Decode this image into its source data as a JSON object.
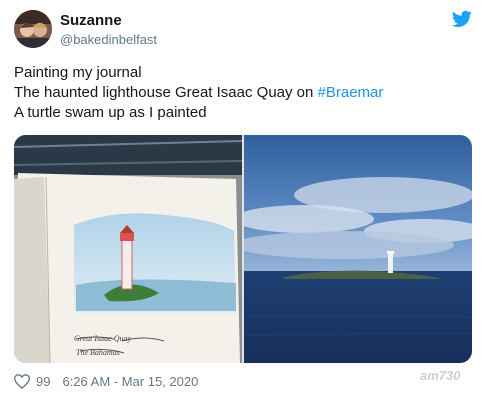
{
  "author": {
    "name": "Suzanne",
    "handle": "@bakedinbelfast"
  },
  "tweet": {
    "line1": "Painting my journal",
    "line2_prefix": "The haunted lighthouse Great Isaac Quay on ",
    "hashtag": "#Braemar",
    "line3": "A turtle swam up as I painted"
  },
  "media": {
    "left_sketch_caption": [
      "Great Isaac Quay",
      "The Bahamas"
    ]
  },
  "footer": {
    "likes": "99",
    "timestamp": "6:26 AM - Mar 15, 2020"
  },
  "watermark": "am730",
  "colors": {
    "link": "#1b95e0",
    "twitter_blue": "#1da1f2",
    "secondary_text": "#657786"
  }
}
